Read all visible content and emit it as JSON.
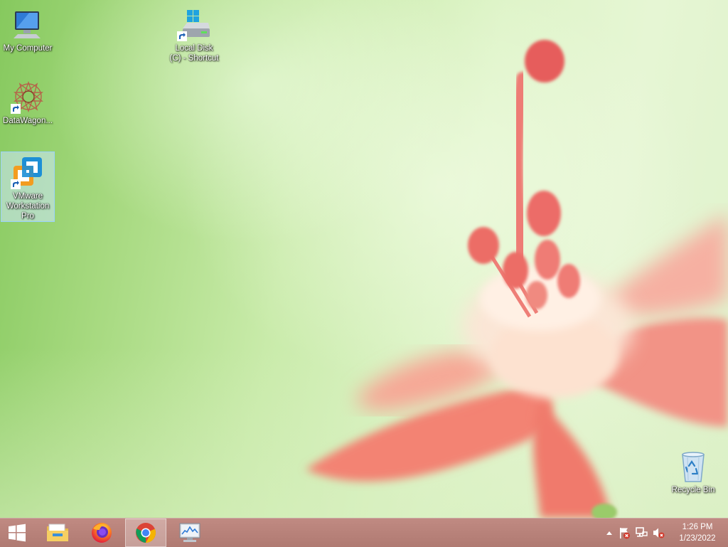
{
  "desktop": {
    "icons": [
      {
        "label": "My Computer",
        "icon": "computer-icon"
      },
      {
        "label": "DataWagon...",
        "icon": "datawagon-icon"
      },
      {
        "label": "VMware Workstation Pro",
        "icon": "vmware-icon",
        "selected": true
      },
      {
        "label": "Local Disk (C) - Shortcut",
        "icon": "drive-icon"
      },
      {
        "label": "Recycle Bin",
        "icon": "recycle-bin-icon"
      }
    ]
  },
  "taskbar": {
    "pinned": [
      {
        "name": "start",
        "icon": "windows-logo-icon"
      },
      {
        "name": "file-explorer",
        "icon": "folder-icon"
      },
      {
        "name": "firefox",
        "icon": "firefox-icon"
      },
      {
        "name": "chrome",
        "icon": "chrome-icon",
        "active": true
      },
      {
        "name": "performance-monitor",
        "icon": "monitor-chart-icon"
      }
    ],
    "tray": {
      "icons": [
        "chevron-up-icon",
        "action-center-flag-icon",
        "network-icon",
        "volume-muted-icon"
      ]
    },
    "clock": {
      "time": "1:26 PM",
      "date": "1/23/2022"
    }
  }
}
